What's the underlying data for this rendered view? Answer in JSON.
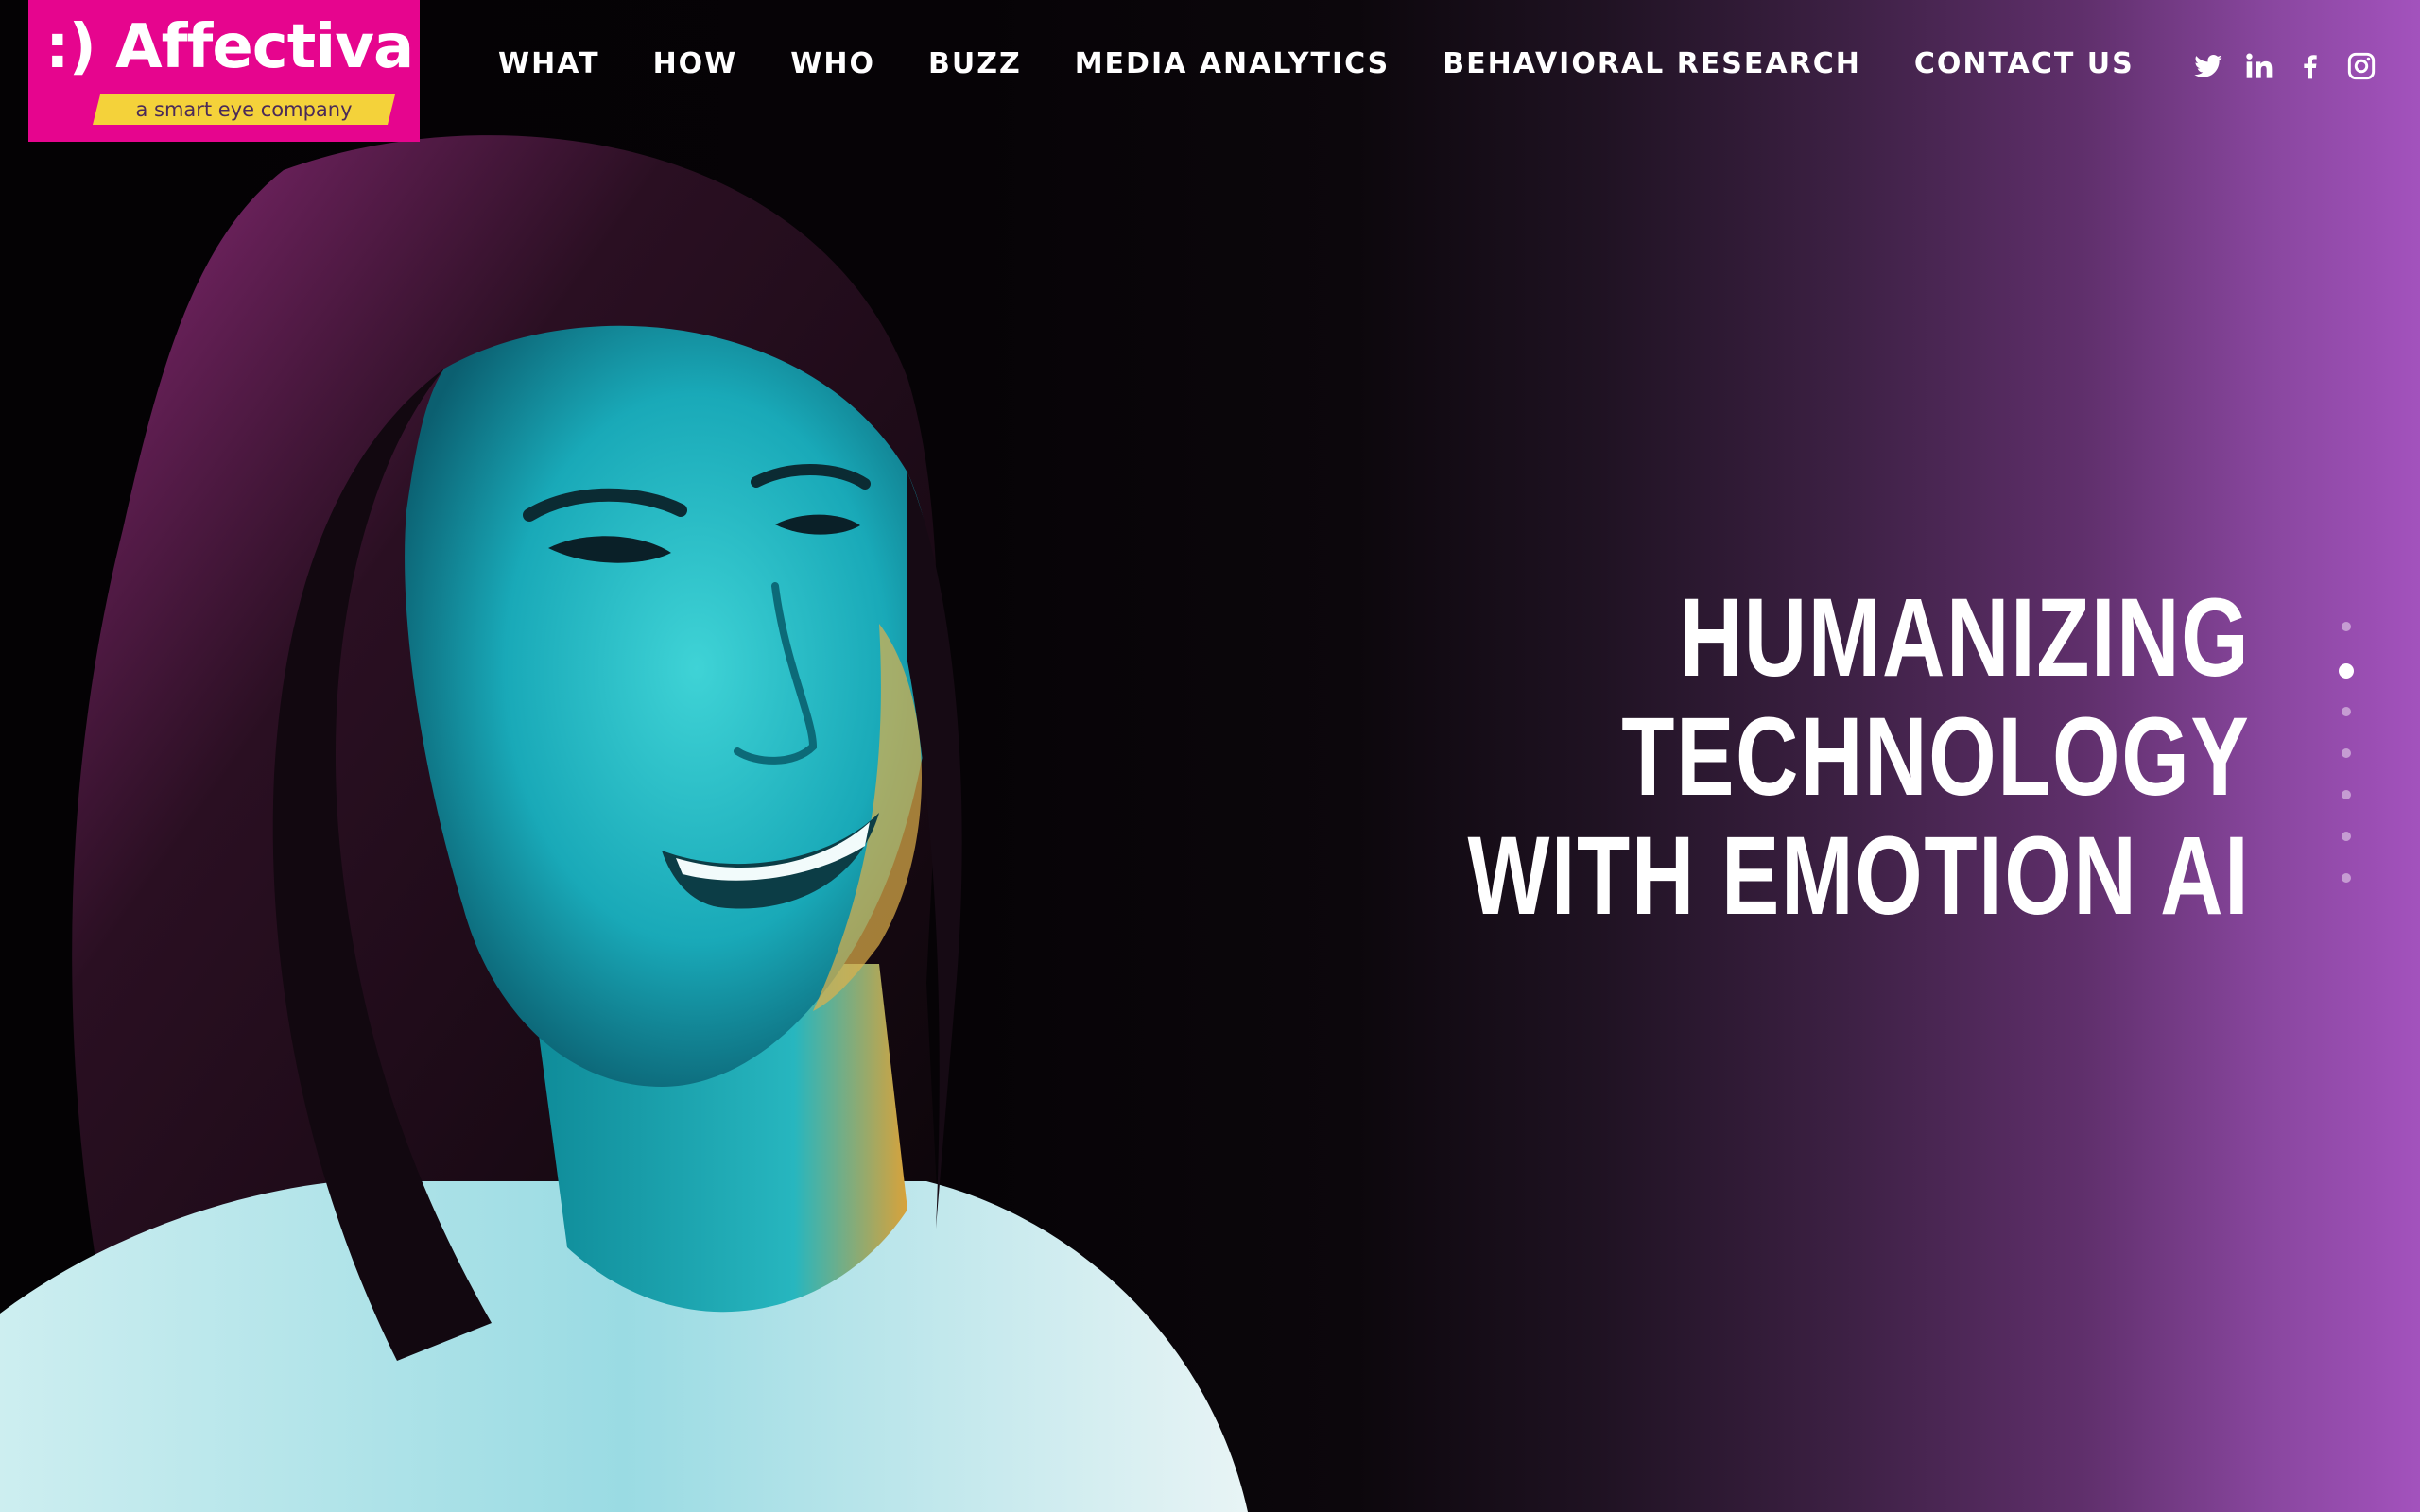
{
  "brand": {
    "logo_smile": ":)",
    "logo_name": "Affectiva",
    "tagline": "a smart eye company",
    "logo_bg_color": "#e6058e",
    "tagline_bg_color": "#f4d23a"
  },
  "nav": {
    "items": [
      {
        "label": "WHAT"
      },
      {
        "label": "HOW"
      },
      {
        "label": "WHO"
      },
      {
        "label": "BUZZ"
      },
      {
        "label": "MEDIA ANALYTICS"
      },
      {
        "label": "BEHAVIORAL RESEARCH"
      },
      {
        "label": "CONTACT US"
      }
    ]
  },
  "social": {
    "icons": [
      "twitter-icon",
      "linkedin-icon",
      "facebook-icon",
      "instagram-icon"
    ]
  },
  "hero": {
    "headline_lines": [
      "HUMANIZING",
      "TECHNOLOGY",
      "WITH EMOTION AI"
    ],
    "slide_count": 7,
    "active_slide": 2,
    "gradient_end_color": "#a352bd"
  }
}
